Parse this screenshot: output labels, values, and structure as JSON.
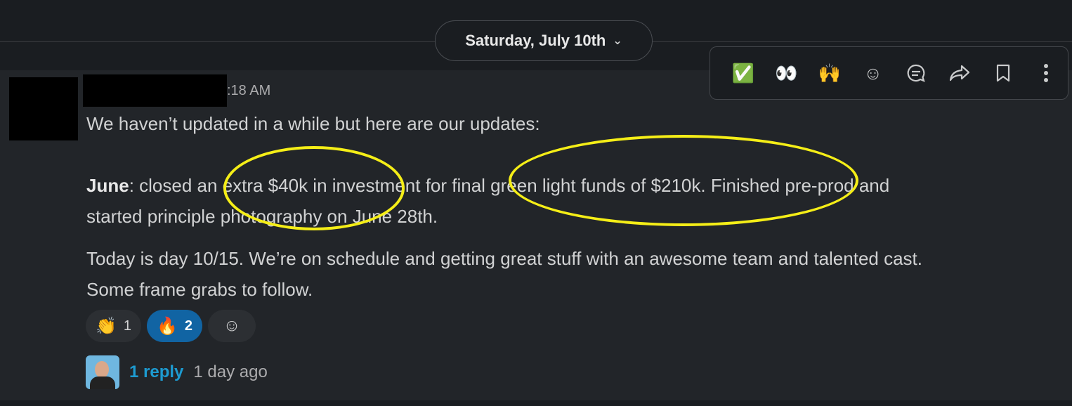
{
  "date_divider": {
    "label": "Saturday, July 10th",
    "chevron": "chevron-down-icon"
  },
  "message": {
    "timestamp": ":18 AM",
    "intro": "We haven’t updated in a while but here are our updates:",
    "june_label": "June",
    "june_line1": ": closed an extra $40k in investment for final green light funds of $210k. Finished pre-prod and",
    "june_line2": "started principle photography on June 28th.",
    "today_line1": "Today is day 10/15. We’re on schedule and getting great stuff with an awesome team and talented cast.",
    "today_line2": "Some frame grabs to follow."
  },
  "toolbar": {
    "items": [
      {
        "icon": "check-mark-emoji",
        "glyph": "✅"
      },
      {
        "icon": "eyes-emoji",
        "glyph": "👀"
      },
      {
        "icon": "raised-hands-emoji",
        "glyph": "🙌"
      },
      {
        "icon": "add-reaction-icon",
        "glyph": "☺"
      },
      {
        "icon": "reply-in-thread-icon",
        "glyph": "💬"
      },
      {
        "icon": "share-icon",
        "glyph": "➦"
      },
      {
        "icon": "bookmark-icon",
        "glyph": "🔖"
      },
      {
        "icon": "more-actions-icon",
        "glyph": "⋮"
      }
    ]
  },
  "reactions": [
    {
      "emoji": "👏",
      "count": "1",
      "active": false
    },
    {
      "emoji": "🔥",
      "count": "2",
      "active": true
    }
  ],
  "add_reaction_glyph": "☺",
  "thread": {
    "reply_label": "1 reply",
    "time": "1 day ago"
  },
  "colors": {
    "highlight_ellipse": "#f5ee17",
    "link": "#1d9bd1",
    "active_reaction": "#1164a3"
  }
}
